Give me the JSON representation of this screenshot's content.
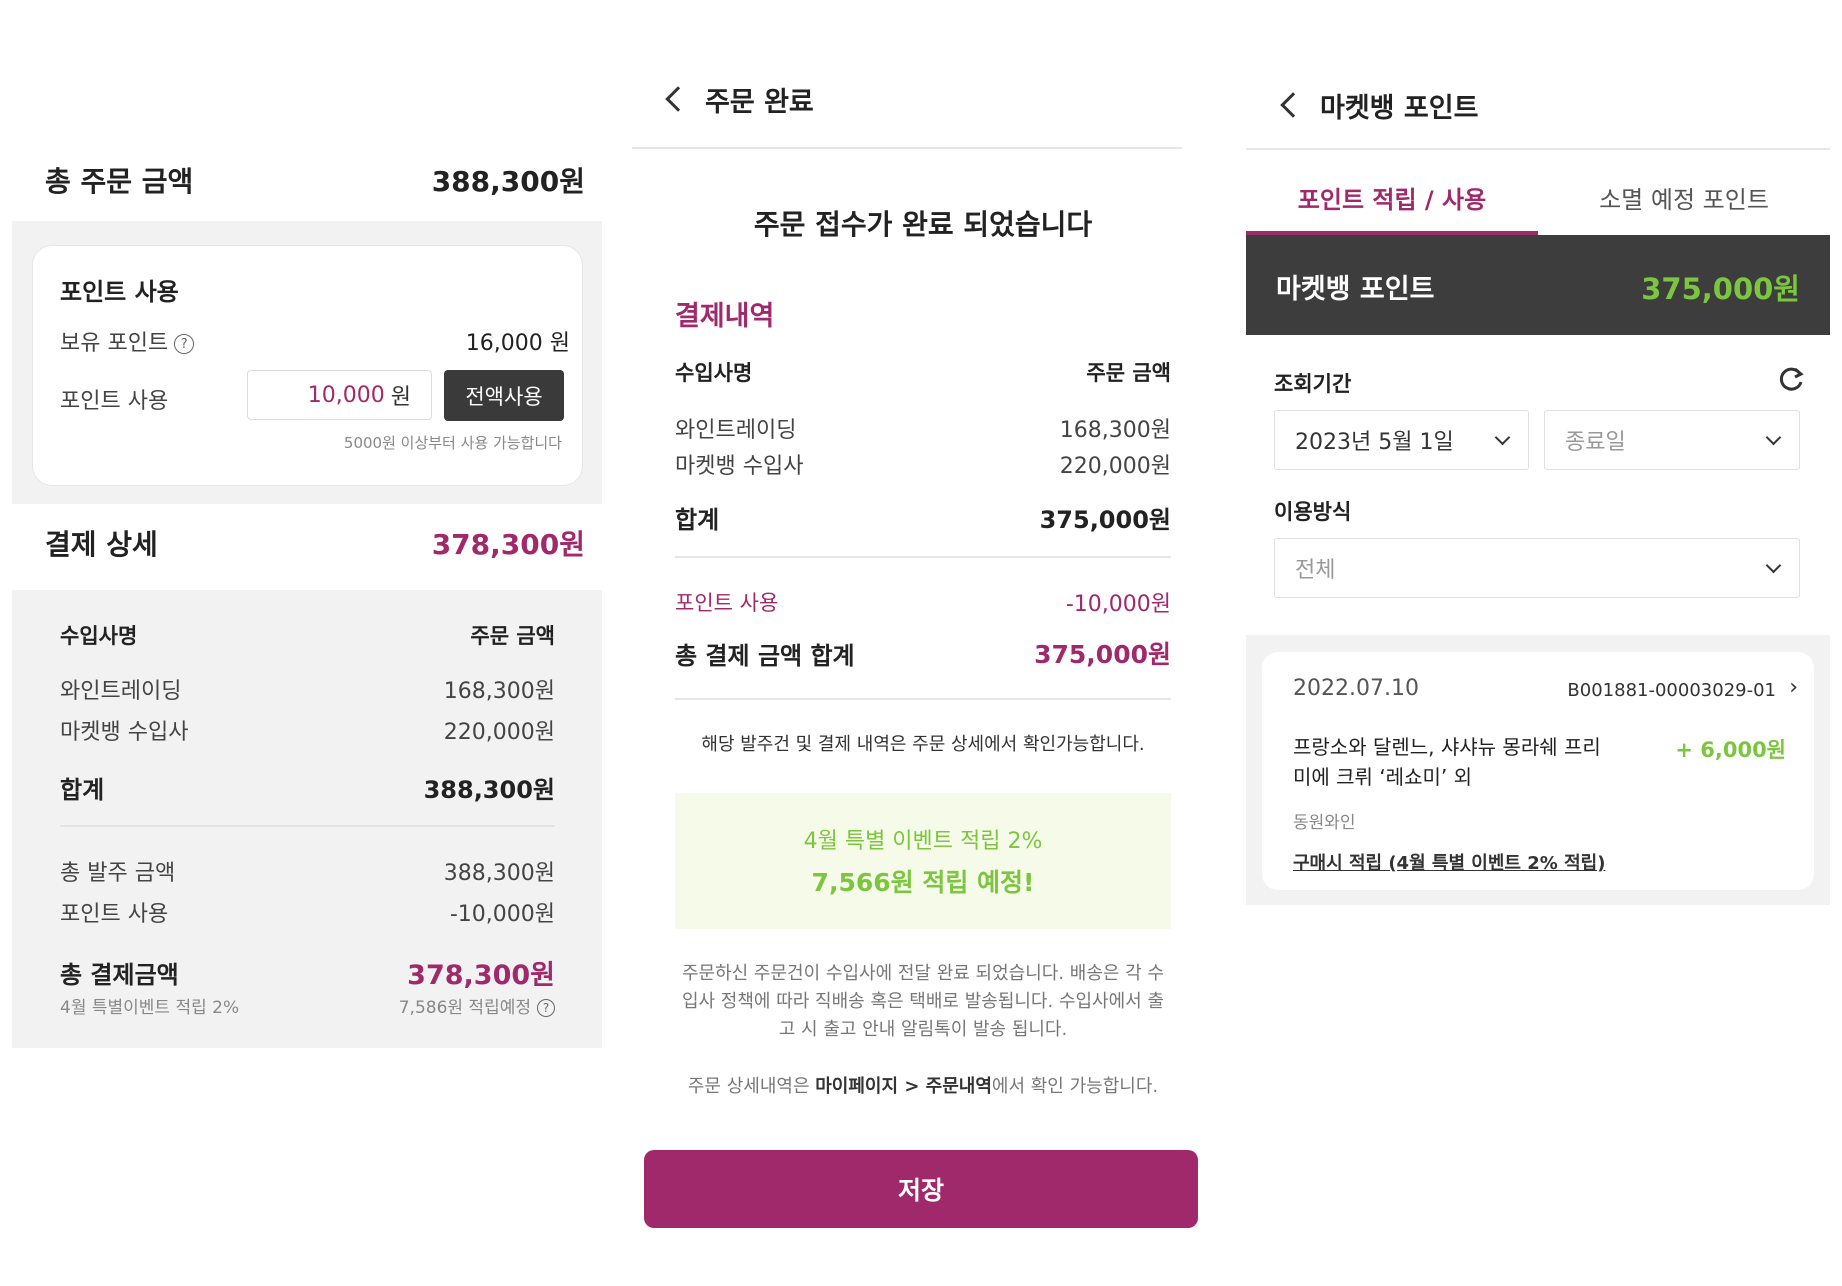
{
  "order_summary": {
    "total_order": {
      "label": "총 주문 금액",
      "value": "388,300원"
    },
    "points": {
      "title": "포인트 사용",
      "owned_label": "보유 포인트",
      "owned_help_icon": "question-circle-icon",
      "owned_value": "16,000 원",
      "use_label": "포인트 사용",
      "use_value": "10,000",
      "use_unit": "원",
      "use_all_button": "전액사용",
      "hint": "5000원 이상부터 사용 가능합니다"
    },
    "payment_detail": {
      "label": "결제 상세",
      "value": "378,300원"
    },
    "table": {
      "col1": "수입사명",
      "col2": "주문 금액",
      "rows": [
        {
          "name": "와인트레이딩",
          "amount": "168,300원"
        },
        {
          "name": "마켓뱅 수입사",
          "amount": "220,000원"
        }
      ],
      "subtotal": {
        "label": "합계",
        "value": "388,300원"
      }
    },
    "order_total": {
      "label": "총 발주 금액",
      "value": "388,300원"
    },
    "point_used": {
      "label": "포인트 사용",
      "value": "-10,000원"
    },
    "final": {
      "label": "총 결제금액",
      "value": "378,300원"
    },
    "event_note": {
      "label": "4월 특별이벤트 적립 2%",
      "value": "7,586원 적립예정",
      "icon": "question-circle-icon"
    }
  },
  "order_complete": {
    "header_title": "주문 완료",
    "back_icon": "chevron-left-icon",
    "headline": "주문 접수가 완료 되었습니다",
    "section_title": "결제내역",
    "col1": "수입사명",
    "col2": "주문 금액",
    "rows": [
      {
        "name": "와인트레이딩",
        "amount": "168,300원"
      },
      {
        "name": "마켓뱅 수입사",
        "amount": "220,000원"
      }
    ],
    "subtotal": {
      "label": "합계",
      "value": "375,000원"
    },
    "point_used": {
      "label": "포인트 사용",
      "value": "-10,000원"
    },
    "grand_total": {
      "label": "총 결제 금액 합계",
      "value": "375,000원"
    },
    "detail_note": "해당 발주건 및 결제 내역은 주문 상세에서 확인가능합니다.",
    "event": {
      "line1": "4월 특별 이벤트 적립 2%",
      "line2": "7,566원 적립 예정!"
    },
    "delivery_note_1": "주문하신 주문건이 수입사에 전달 완료 되었습니다. 배송은 각 수",
    "delivery_note_2": "입사 정책에 따라 직배송 혹은 택배로 발송됩니다. 수입사에서 출",
    "delivery_note_3": "고 시 출고 안내 알림톡이 발송 됩니다.",
    "mypage_note_pre": "주문 상세내역은 ",
    "mypage_note_path": "마이페이지 > 주문내역",
    "mypage_note_post": "에서 확인 가능합니다.",
    "save_button": "저장"
  },
  "market_points": {
    "header_title": "마켓뱅 포인트",
    "back_icon": "chevron-left-icon",
    "tabs": [
      {
        "label": "포인트 적립 / 사용",
        "active": true
      },
      {
        "label": "소멸 예정 포인트",
        "active": false
      }
    ],
    "balance": {
      "label": "마켓뱅 포인트",
      "value": "375,000원"
    },
    "period_label": "조회기간",
    "refresh_icon": "refresh-icon",
    "start_date": "2023년 5월 1일",
    "end_date_placeholder": "종료일",
    "method_label": "이용방식",
    "method_value": "전체",
    "record": {
      "date": "2022.07.10",
      "order_no": "B001881-00003029-01",
      "item_line1": "프랑소와 달렌느, 샤샤뉴 몽라쉐 프리",
      "item_line2": "미에 크뤼 ‘레쇼미’ 외",
      "points": "+ 6,000원",
      "seller": "동원와인",
      "reason": "구매시 적립 (4월 특별 이벤트 2% 적립)"
    }
  },
  "colors": {
    "accent": "#a0296c",
    "green": "#7cc63f",
    "dark": "#3d3d3d",
    "light_bg": "#f2f2f2",
    "event_bg": "#f6fbe9"
  }
}
